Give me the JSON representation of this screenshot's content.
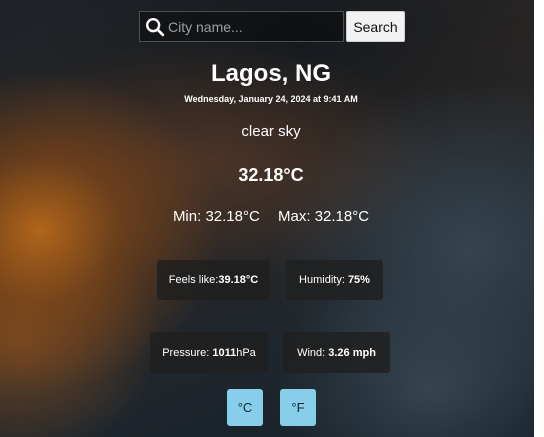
{
  "search": {
    "placeholder": "City name...",
    "value": "",
    "button_label": "Search"
  },
  "weather": {
    "city": "Lagos, NG",
    "datetime": "Wednesday, January 24, 2024 at 9:41 AM",
    "description": "clear sky",
    "temperature": "32.18°C",
    "min_label": "Min:",
    "min_value": "32.18°C",
    "max_label": "Max:",
    "max_value": "32.18°C"
  },
  "details": {
    "feels_like_label": "Feels like:",
    "feels_like_value": "39.18°C",
    "humidity_label": "Humidity:",
    "humidity_value": "75%",
    "pressure_label": "Pressure:",
    "pressure_value": "1011",
    "pressure_unit": "hPa",
    "wind_label": "Wind:",
    "wind_value": "3.26 mph"
  },
  "units": {
    "celsius_label": "°C",
    "fahrenheit_label": "°F"
  },
  "icons": {
    "search": "search-icon"
  },
  "colors": {
    "unit_button": "#87ceeb",
    "card_background": "#202020",
    "search_button": "#f2f2f2"
  }
}
